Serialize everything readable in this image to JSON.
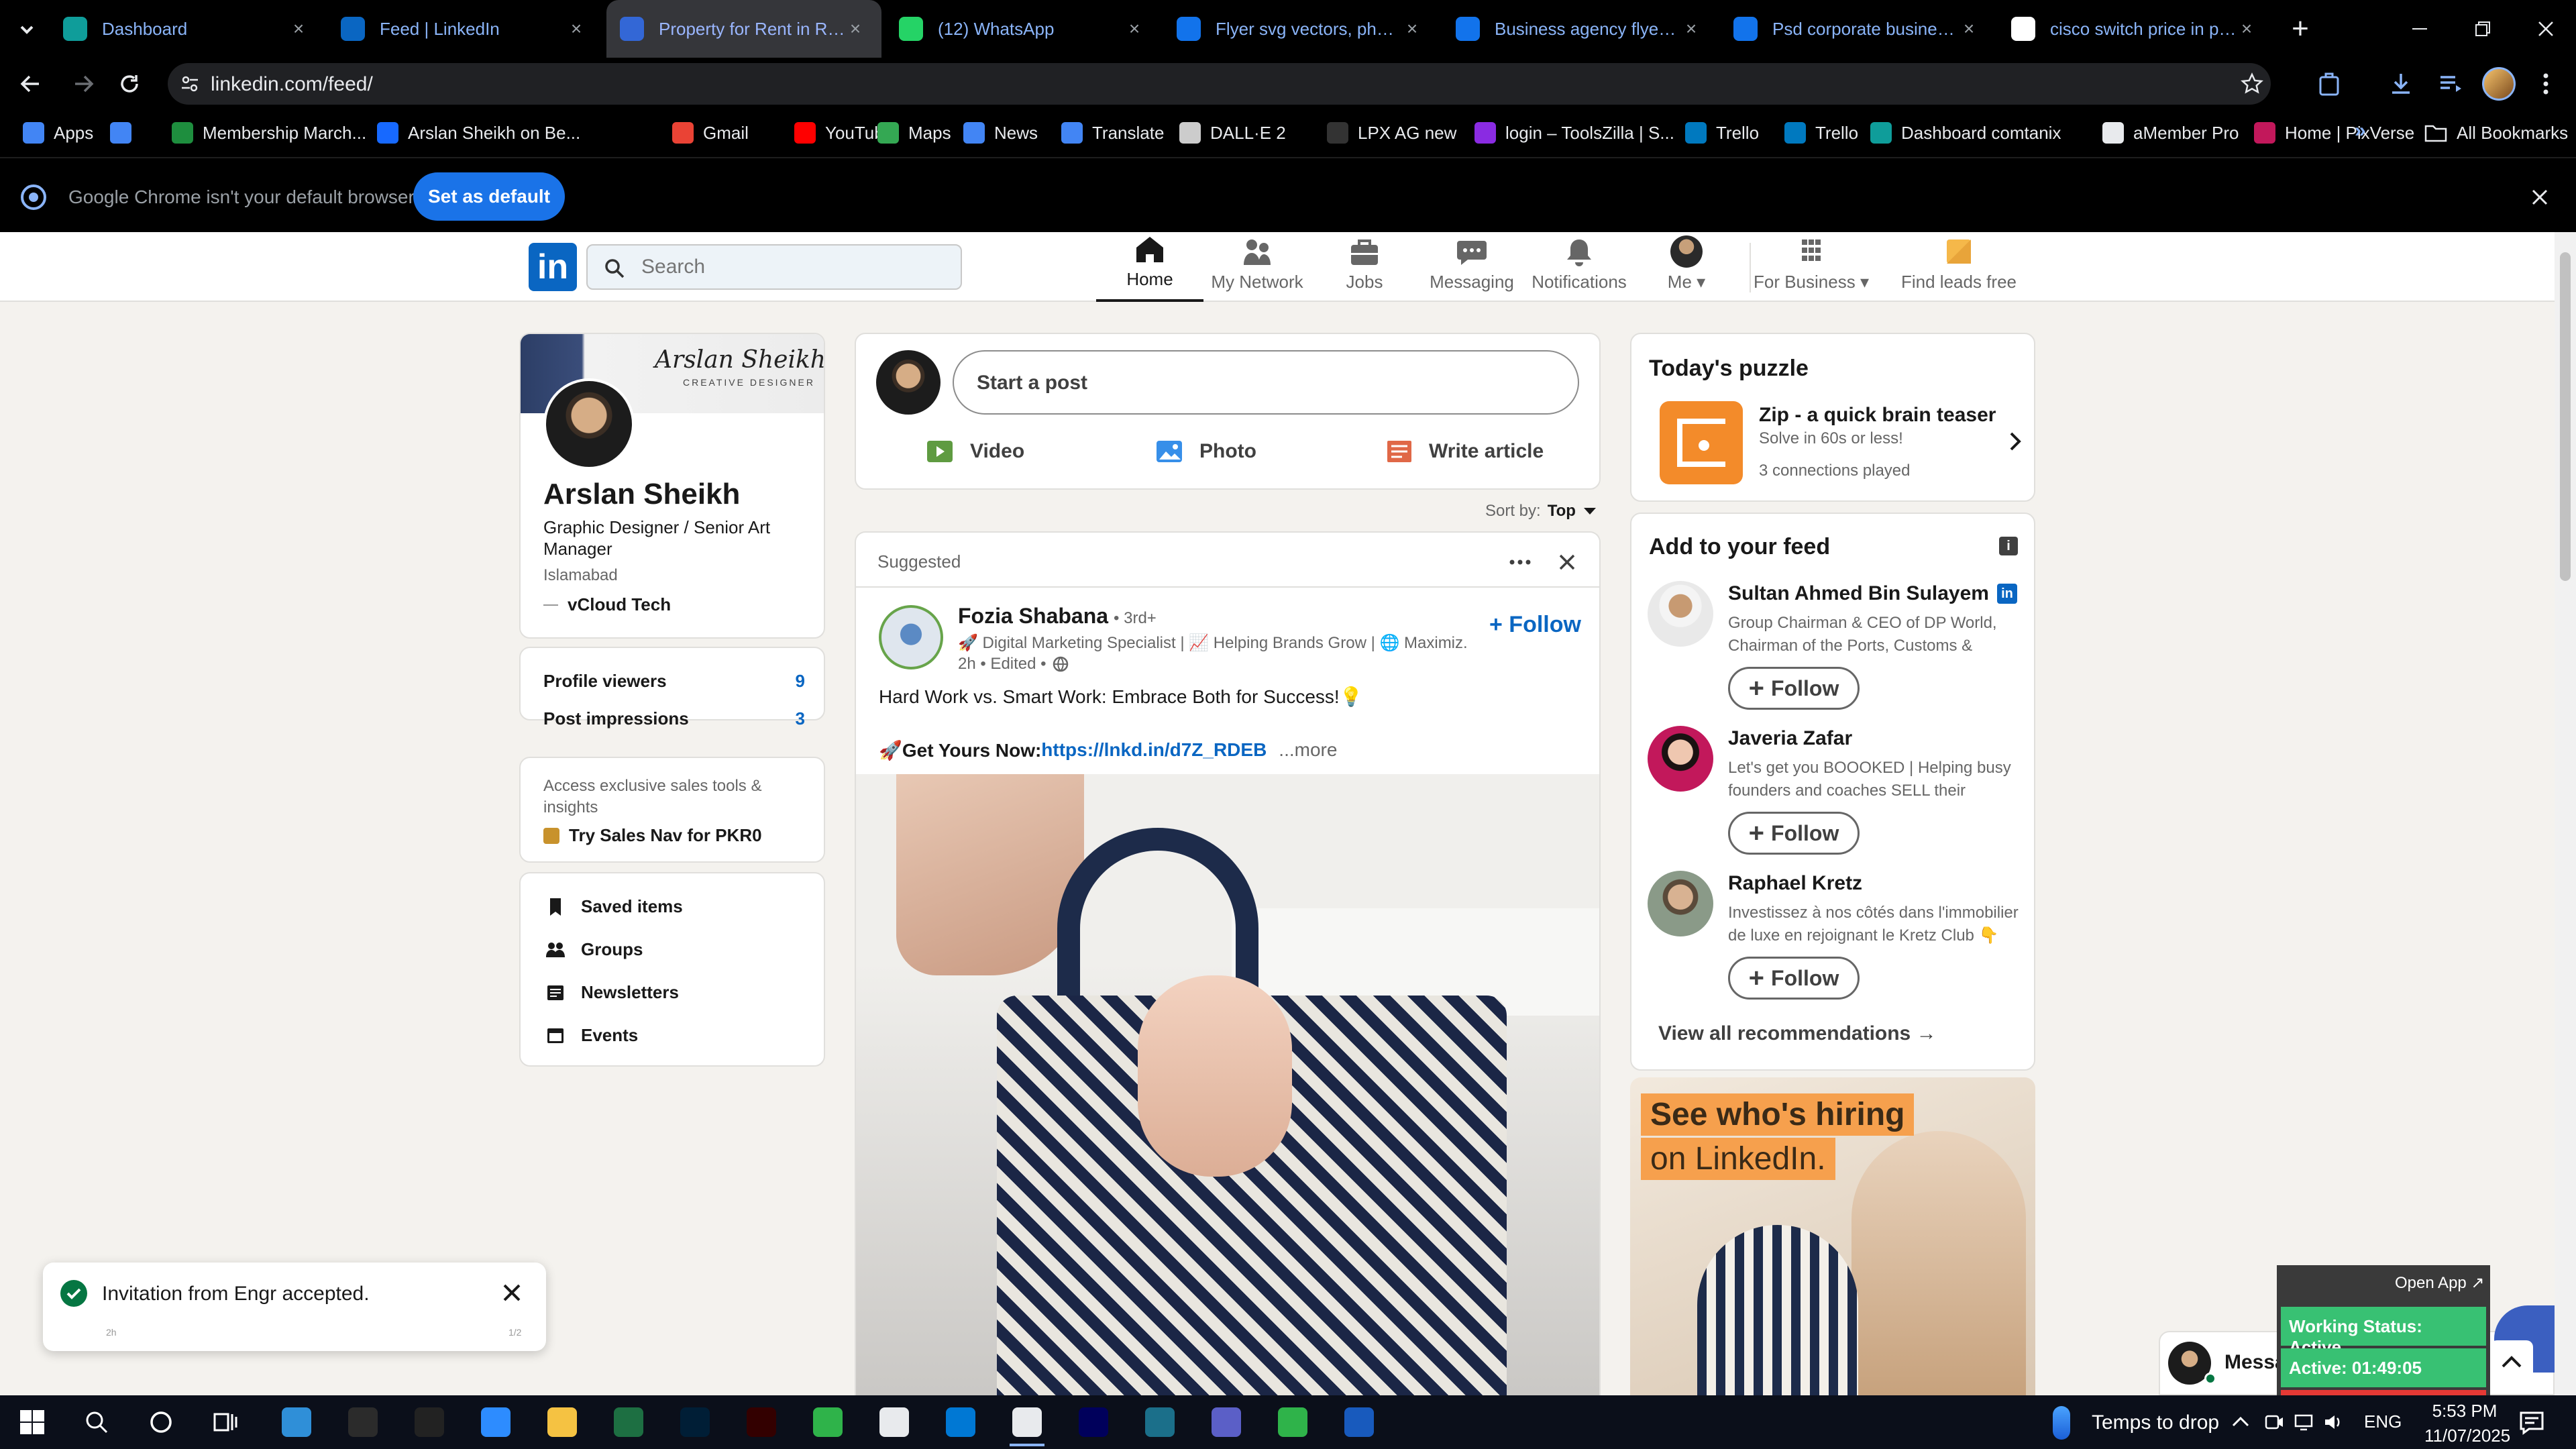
{
  "browser": {
    "tabs": [
      {
        "title": "Dashboard",
        "favicon": "dashboard-icon",
        "color": "#0f9d9a"
      },
      {
        "title": "Feed | LinkedIn",
        "favicon": "linkedin-icon",
        "color": "#0a66c2"
      },
      {
        "title": "Property for Rent in Rawalpindi",
        "favicon": "property-icon",
        "color": "#3367d6"
      },
      {
        "title": "(12) WhatsApp",
        "favicon": "whatsapp-icon",
        "color": "#25d366"
      },
      {
        "title": "Flyer svg vectors, photos",
        "favicon": "freepik-icon",
        "color": "#1273eb"
      },
      {
        "title": "Business agency flyer | Premium",
        "favicon": "freepik-icon",
        "color": "#1273eb"
      },
      {
        "title": "Psd corporate business flyer",
        "favicon": "freepik-icon",
        "color": "#1273eb"
      },
      {
        "title": "cisco switch price in pakistan",
        "favicon": "google-icon",
        "color": "#ffffff"
      }
    ],
    "url": "linkedin.com/feed/",
    "bookmarks": [
      {
        "label": "Apps",
        "color": "#4285f4"
      },
      {
        "label": "",
        "color": "#4285f4"
      },
      {
        "label": "Membership March...",
        "color": "#1e8e3e"
      },
      {
        "label": "Arslan Sheikh on Be...",
        "color": "#1769ff"
      },
      {
        "label": "Gmail",
        "color": "#ea4335"
      },
      {
        "label": "YouTube",
        "color": "#ff0000"
      },
      {
        "label": "Maps",
        "color": "#34a853"
      },
      {
        "label": "News",
        "color": "#4285f4"
      },
      {
        "label": "Translate",
        "color": "#4285f4"
      },
      {
        "label": "DALL·E 2",
        "color": "#cccccc"
      },
      {
        "label": "LPX AG new",
        "color": "#333333"
      },
      {
        "label": "login – ToolsZilla | S...",
        "color": "#8a2be2"
      },
      {
        "label": "Trello",
        "color": "#0079bf"
      },
      {
        "label": "Trello",
        "color": "#0079bf"
      },
      {
        "label": "Dashboard comtanix",
        "color": "#0f9d9a"
      },
      {
        "label": "aMember Pro",
        "color": "#e8eaed"
      },
      {
        "label": "Home | PixVerse",
        "color": "#c2185b"
      }
    ],
    "all_bookmarks": "All Bookmarks",
    "default_bar": {
      "message": "Google Chrome isn't your default browser",
      "button": "Set as default"
    }
  },
  "linkedin": {
    "search_placeholder": "Search",
    "nav": [
      {
        "label": "Home",
        "icon": "home-icon"
      },
      {
        "label": "My Network",
        "icon": "network-icon"
      },
      {
        "label": "Jobs",
        "icon": "jobs-icon"
      },
      {
        "label": "Messaging",
        "icon": "messaging-icon"
      },
      {
        "label": "Notifications",
        "icon": "bell-icon"
      },
      {
        "label": "Me",
        "icon": "avatar"
      },
      {
        "label": "For Business",
        "icon": "grid-icon"
      },
      {
        "label": "Find leads free",
        "icon": "leads-icon"
      }
    ],
    "profile": {
      "banner_signature": "Arslan Sheikh",
      "banner_subtitle": "CREATIVE DESIGNER",
      "name": "Arslan Sheikh",
      "headline": "Graphic Designer / Senior Art Manager",
      "location": "Islamabad",
      "company": "vCloud Tech",
      "stats": [
        {
          "label": "Profile viewers",
          "value": "9"
        },
        {
          "label": "Post impressions",
          "value": "3"
        }
      ],
      "premium_text": "Access exclusive sales tools & insights",
      "premium_cta": "Try Sales Nav for PKR0",
      "links": [
        {
          "label": "Saved items",
          "icon": "bookmark-icon"
        },
        {
          "label": "Groups",
          "icon": "groups-icon"
        },
        {
          "label": "Newsletters",
          "icon": "newsletter-icon"
        },
        {
          "label": "Events",
          "icon": "calendar-icon"
        }
      ]
    },
    "composer": {
      "placeholder": "Start a post",
      "actions": [
        {
          "label": "Video",
          "icon": "video-icon",
          "color": "#5f9b41"
        },
        {
          "label": "Photo",
          "icon": "photo-icon",
          "color": "#378fe9"
        },
        {
          "label": "Write article",
          "icon": "article-icon",
          "color": "#e06847"
        }
      ]
    },
    "sort": {
      "label": "Sort by:",
      "value": "Top"
    },
    "post": {
      "context": "Suggested",
      "author": "Fozia Shabana",
      "degree": "• 3rd+",
      "subtitle": "🚀 Digital Marketing Specialist | 📈 Helping Brands Grow | 🌐 Maximiz...",
      "meta": "2h • Edited •",
      "follow": "+ Follow",
      "text": "Hard Work vs. Smart Work: Embrace Both for Success!💡",
      "cta_prefix": "🚀Get Yours Now:",
      "cta_link": "https://lnkd.in/d7Z_RDEB",
      "more": "...more"
    },
    "puzzle": {
      "heading": "Today's puzzle",
      "title": "Zip - a quick brain teaser",
      "desc": "Solve in 60s or less!",
      "meta": "3 connections played"
    },
    "feed_recs": {
      "heading": "Add to your feed",
      "people": [
        {
          "name": "Sultan Ahmed Bin Sulayem",
          "desc": "Group Chairman & CEO of DP World, Chairman of the Ports, Customs & Free...",
          "follow": "Follow"
        },
        {
          "name": "Javeria Zafar",
          "desc": "Let's get you BOOOKED | Helping busy founders and coaches SELL their servic...",
          "follow": "Follow"
        },
        {
          "name": "Raphael Kretz",
          "desc": "Investissez à nos côtés dans l'immobilier de luxe en rejoignant le Kretz Club 👇",
          "follow": "Follow"
        }
      ],
      "view_all": "View all recommendations →"
    },
    "ad": {
      "line1": "See who's hiring",
      "line2": "on LinkedIn."
    },
    "toast": {
      "text": "Invitation from Engr accepted.",
      "time": "2h",
      "counter": "1/2"
    },
    "messaging": {
      "label": "Messaging"
    }
  },
  "overlay": {
    "open_app": "Open App ↗",
    "status": "Working Status: Active",
    "active": "Active: 01:49:05"
  },
  "taskbar": {
    "weather": "Temps to drop",
    "lang": "ENG",
    "time": "5:53 PM",
    "date": "11/07/2025"
  }
}
